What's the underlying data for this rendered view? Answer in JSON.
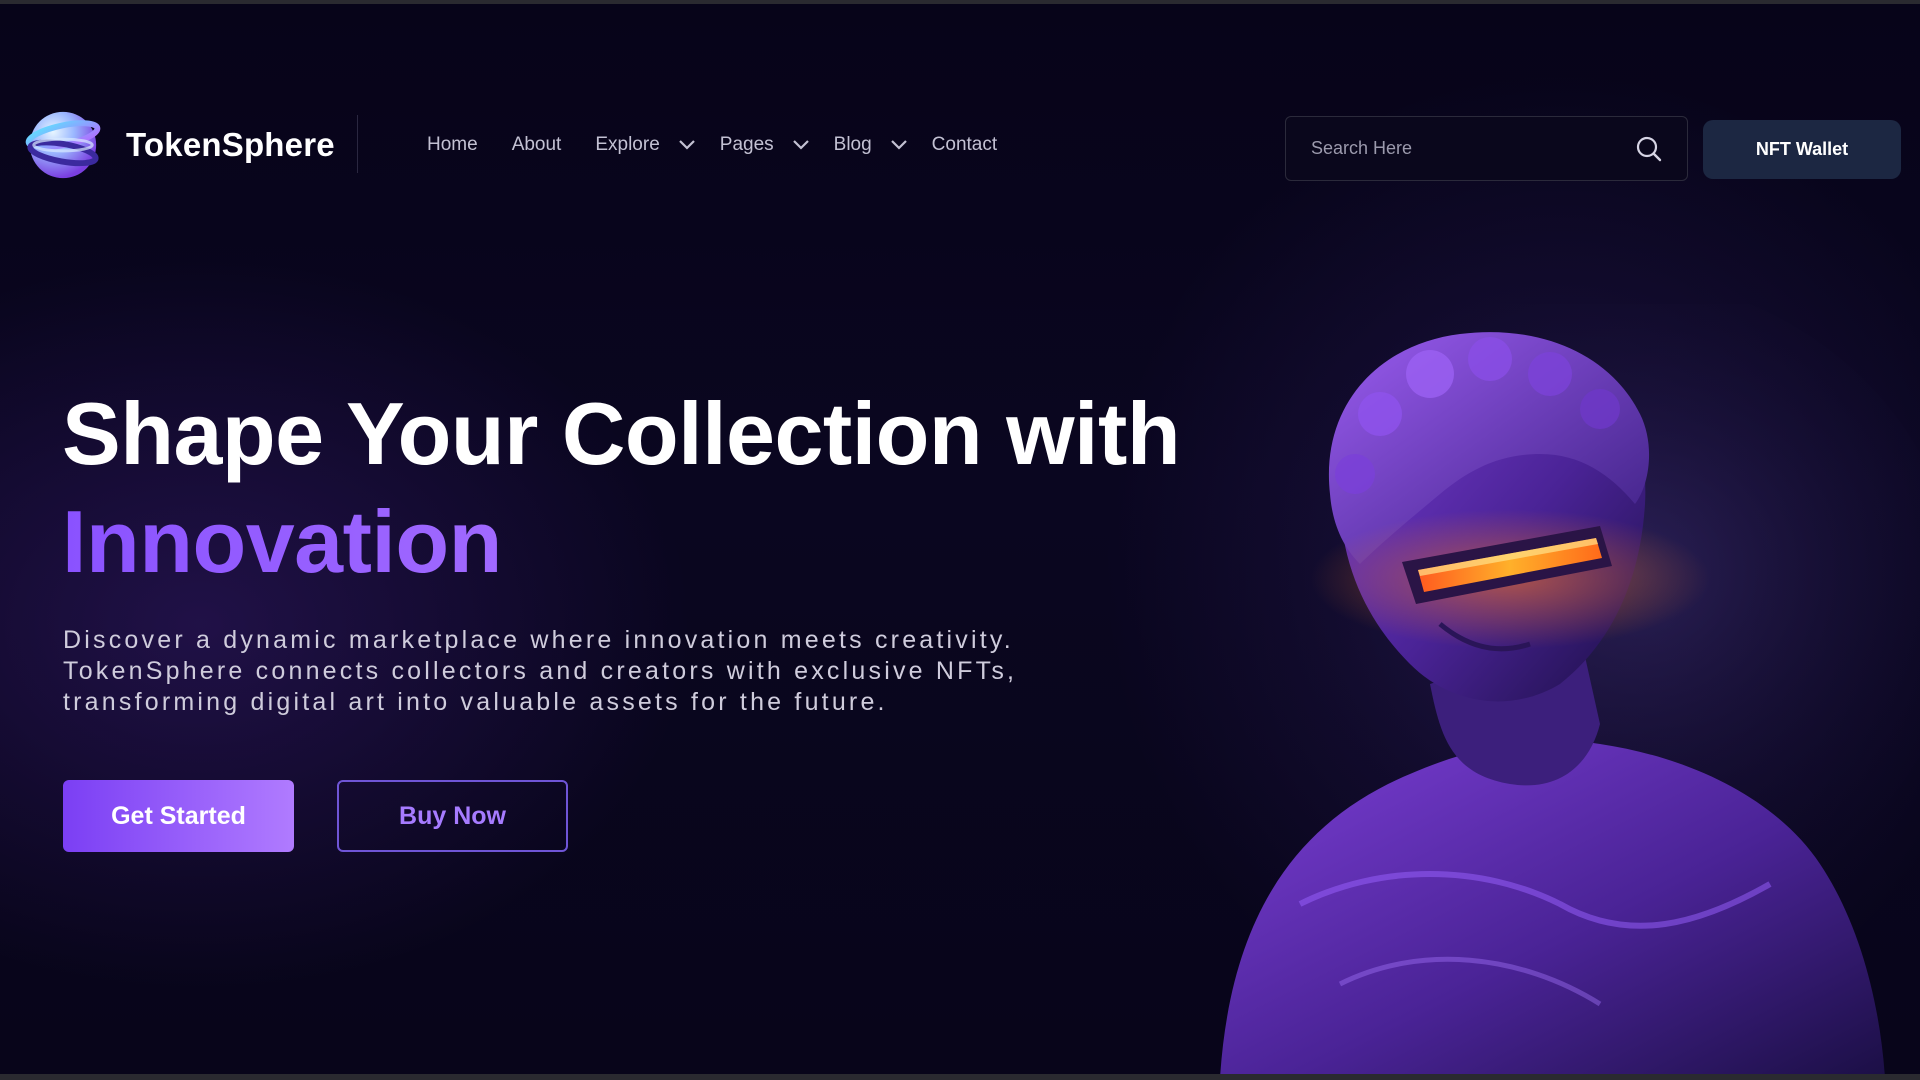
{
  "header": {
    "brand": "TokenSphere",
    "logo_icon": "sphere-logo-icon",
    "nav": [
      {
        "label": "Home",
        "dropdown": false
      },
      {
        "label": "About",
        "dropdown": false
      },
      {
        "label": "Explore",
        "dropdown": true
      },
      {
        "label": "Pages",
        "dropdown": true
      },
      {
        "label": "Blog",
        "dropdown": true
      },
      {
        "label": "Contact",
        "dropdown": false
      }
    ],
    "search_placeholder": "Search Here",
    "wallet_label": "NFT Wallet"
  },
  "hero": {
    "title_line1": "Shape Your Collection with",
    "title_line2": "Innovation",
    "description": "Discover a dynamic marketplace where innovation meets creativity. TokenSphere connects collectors and creators with exclusive NFTs, transforming digital art into valuable assets for the future.",
    "primary_button": "Get Started",
    "secondary_button": "Buy Now"
  },
  "colors": {
    "background": "#07051a",
    "accent": "#8a52ff",
    "wallet_button": "#1c2742",
    "visor_glow": "#ff8a1a"
  }
}
